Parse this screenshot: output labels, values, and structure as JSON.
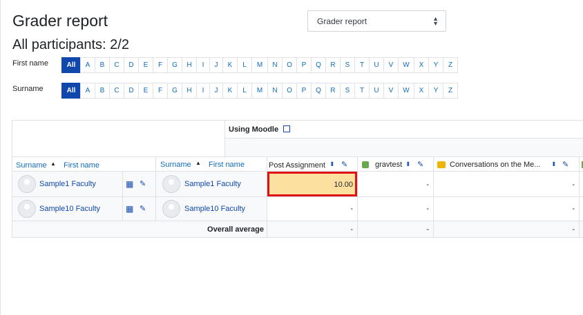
{
  "title": "Grader report",
  "participants": "All participants: 2/2",
  "view_select": {
    "value": "Grader report"
  },
  "filters": {
    "first_name_label": "First name",
    "surname_label": "Surname",
    "letters": [
      "All",
      "A",
      "B",
      "C",
      "D",
      "E",
      "F",
      "G",
      "H",
      "I",
      "J",
      "K",
      "L",
      "M",
      "N",
      "O",
      "P",
      "Q",
      "R",
      "S",
      "T",
      "U",
      "V",
      "W",
      "X",
      "Y",
      "Z"
    ]
  },
  "grid": {
    "category": "Using Moodle",
    "col_surname": "Surname",
    "col_first": "First name",
    "items": [
      "Post Assignment",
      "gravtest",
      "Conversations on the Me..."
    ],
    "rows": [
      {
        "name": "Sample1 Faculty",
        "values": [
          "10.00",
          "-",
          "-"
        ]
      },
      {
        "name": "Sample10 Faculty",
        "values": [
          "-",
          "-",
          "-"
        ]
      }
    ],
    "overall_label": "Overall average",
    "overall_values": [
      "-",
      "-",
      "-"
    ]
  }
}
